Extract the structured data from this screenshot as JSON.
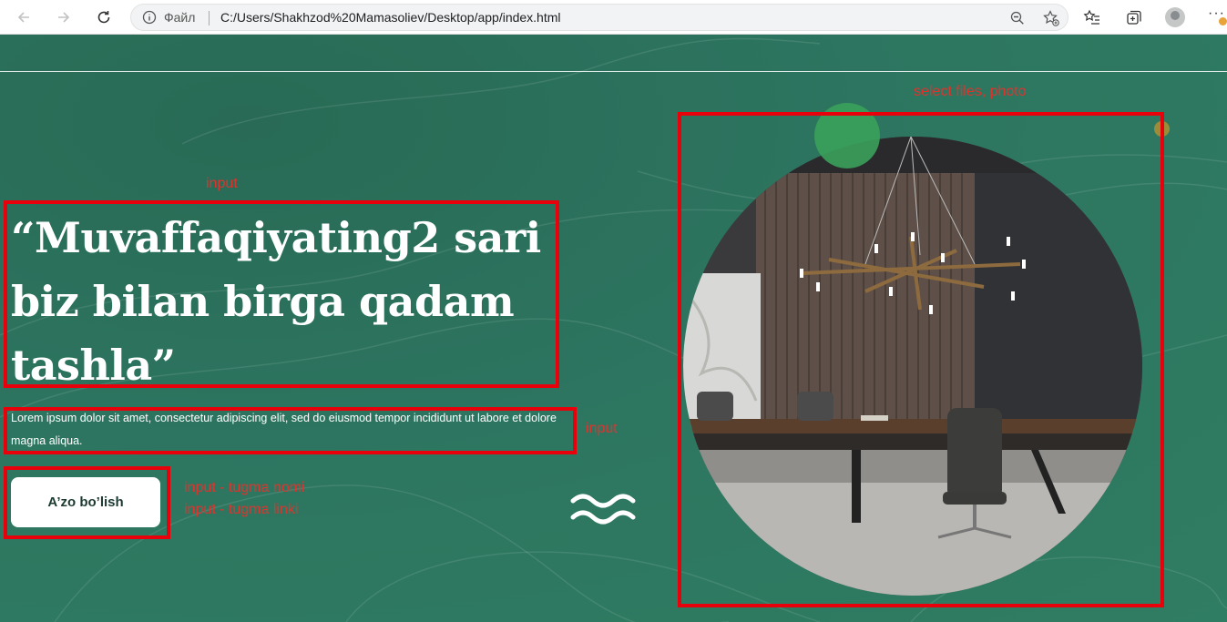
{
  "browser": {
    "address_prefix": "Файл",
    "url": "C:/Users/Shakhzod%20Mamasoliev/Desktop/app/index.html"
  },
  "annotations": {
    "title_note": "input",
    "desc_note": "input",
    "button_note_1": "input - tugma nomi",
    "button_note_2": "input - tugma linki",
    "photo_note": "select files, photo",
    "color": "#e8000b"
  },
  "hero": {
    "title": "“Muvaffaqiyating2 sari biz bilan birga qadam tashla”",
    "description": "Lorem ipsum dolor sit amet, consectetur adipiscing elit, sed do eiusmod tempor incididunt ut labore et dolore magna aliqua.",
    "button_label": "A’zo bo’lish"
  },
  "colors": {
    "background": "#2e7a5e",
    "accent_green": "#3aa15a",
    "highlight_red": "#e8000b"
  }
}
